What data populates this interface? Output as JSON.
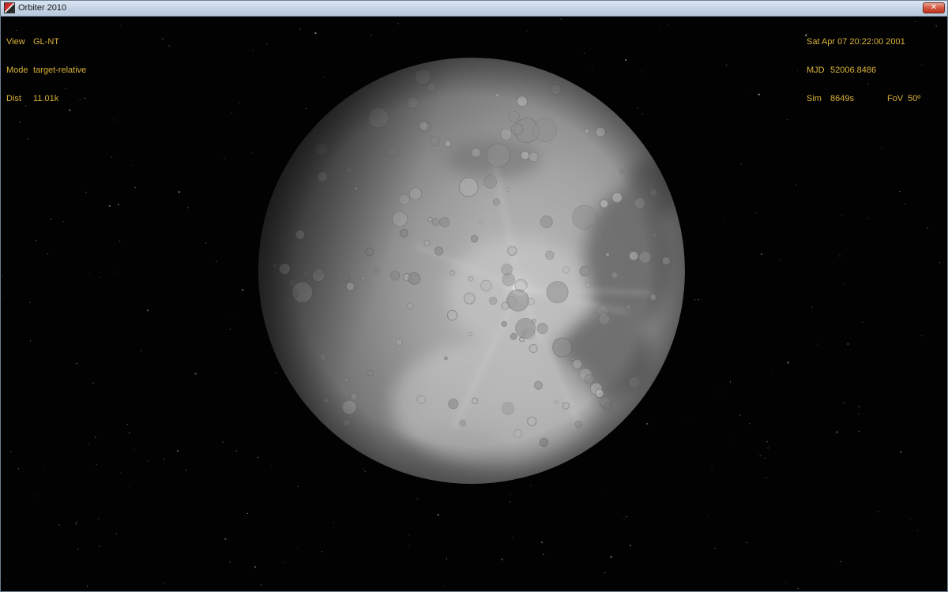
{
  "window": {
    "title": "Orbiter 2010",
    "close_glyph": "✕",
    "app_icon": "orbiter-logo-icon"
  },
  "hud_left": {
    "view_label": "View",
    "view_value": "GL-NT",
    "mode_label": "Mode",
    "mode_value": "target-relative",
    "dist_label": "Dist",
    "dist_value": "11.01k"
  },
  "hud_right": {
    "datetime": "Sat Apr 07 20:22:00 2001",
    "mjd_label": "MJD",
    "mjd_value": "52006.8486",
    "sim_label": "Sim",
    "sim_value": "8649s",
    "fov_label": "FoV",
    "fov_value": "50º"
  },
  "colors": {
    "hud_text": "#d9b23a",
    "space": "#020202",
    "titlebar": "#c3d3e4"
  }
}
